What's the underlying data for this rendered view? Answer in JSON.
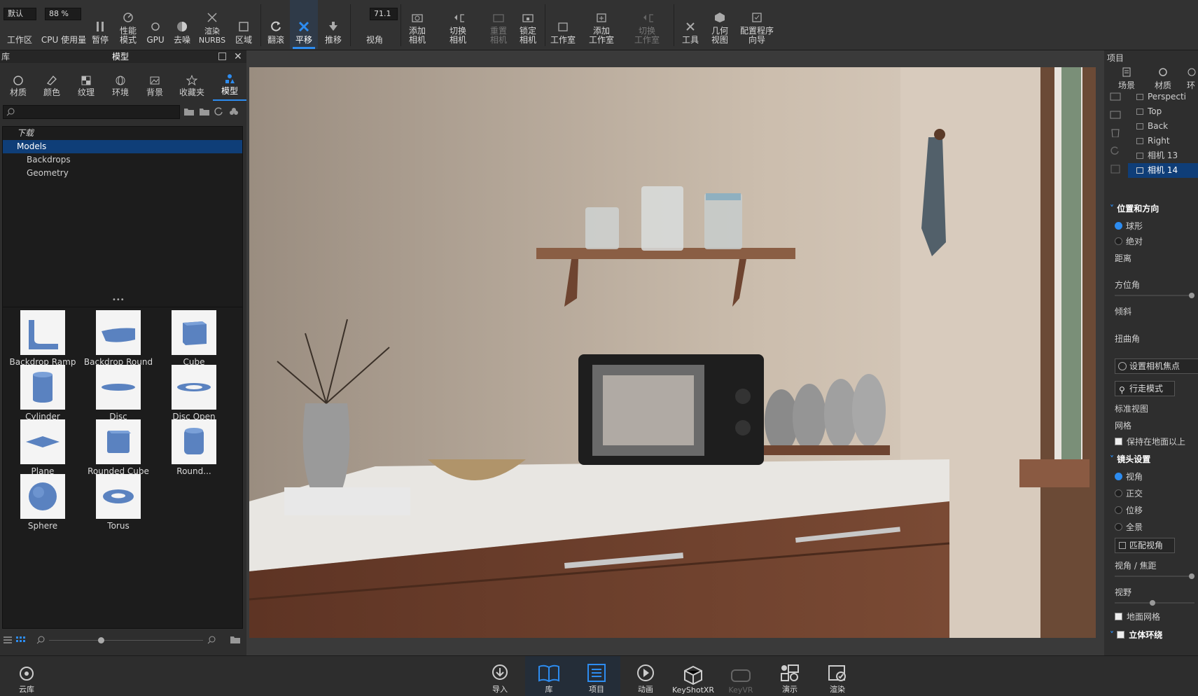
{
  "toolbar": {
    "preset_value": "默认",
    "zoom_value": "88 %",
    "fov_value": "71.1",
    "items": [
      {
        "label": "工作区"
      },
      {
        "label": "CPU 使用量"
      },
      {
        "label": "暂停"
      },
      {
        "label": "性能\n模式"
      },
      {
        "label": "GPU"
      },
      {
        "label": "去噪"
      },
      {
        "label": "渲染\nNURBS"
      },
      {
        "label": "区域"
      },
      {
        "label": "翻滚"
      },
      {
        "label": "平移"
      },
      {
        "label": "推移"
      },
      {
        "label": "视角"
      },
      {
        "label": "添加\n相机"
      },
      {
        "label": "切换\n相机"
      },
      {
        "label": "重置\n相机"
      },
      {
        "label": "锁定\n相机"
      },
      {
        "label": "工作室"
      },
      {
        "label": "添加\n工作室"
      },
      {
        "label": "切换\n工作室"
      },
      {
        "label": "工具"
      },
      {
        "label": "几何\n视图"
      },
      {
        "label": "配置程序\n向导"
      }
    ]
  },
  "library": {
    "panel_left_title": "库",
    "panel_title": "模型",
    "tabs": [
      "材质",
      "颜色",
      "纹理",
      "环境",
      "背景",
      "收藏夹",
      "模型"
    ],
    "search_placeholder": "",
    "tree": [
      "下载",
      "Models",
      "Backdrops",
      "Geometry"
    ],
    "models": [
      "Backdrop Ramp",
      "Backdrop Round",
      "Cube",
      "Cylinder",
      "Disc",
      "Disc Open",
      "Plane",
      "Rounded Cube",
      "Round...",
      "Sphere",
      "Torus"
    ]
  },
  "project": {
    "title": "项目",
    "tabs": [
      "场景",
      "材质",
      "环"
    ],
    "cameras": [
      "Perspecti",
      "Top",
      "Back",
      "Right",
      "相机 13",
      "相机 14"
    ],
    "section_position": "位置和方向",
    "opt_spherical": "球形",
    "opt_absolute": "绝对",
    "distance": "距离",
    "azimuth": "方位角",
    "inclination": "倾斜",
    "twist": "扭曲角",
    "btn_focus": "设置相机焦点",
    "btn_walk": "行走模式",
    "standard_view": "标准视图",
    "grid": "网格",
    "keep_above": "保持在地面以上",
    "section_lens": "镜头设置",
    "opt_fov": "视角",
    "opt_ortho": "正交",
    "opt_shift": "位移",
    "opt_pano": "全景",
    "btn_match": "匹配视角",
    "fov_focal": "视角 / 焦距",
    "field_of_view": "视野",
    "ground_grid": "地面网格",
    "section_stereo": "立体环绕"
  },
  "bottom": {
    "cloud": "云库",
    "items": [
      "导入",
      "库",
      "项目",
      "动画",
      "KeyShotXR",
      "KeyVR",
      "演示",
      "渲染"
    ]
  },
  "colors": {
    "accent": "#2d8cf0",
    "selection": "#0f3e78"
  }
}
